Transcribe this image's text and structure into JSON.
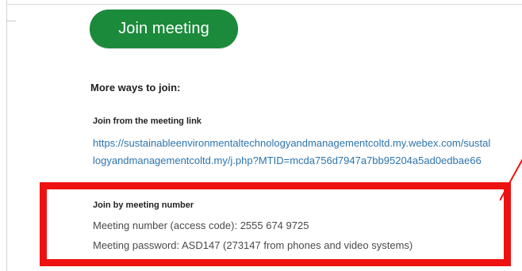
{
  "button": {
    "label": "Join meeting",
    "color": "#1b8a3b"
  },
  "more_ways": {
    "title": "More ways to join:"
  },
  "link_section": {
    "label": "Join from the meeting link",
    "line1": "https://sustainableenvironmentaltechnologyandmanagementcoltd.my.webex.com/sustal",
    "line2": "logyandmanagementcoltd.my/j.php?MTID=mcda756d7947a7bb95204a5ad0edbae66",
    "color": "#2c74ad"
  },
  "number_section": {
    "label": "Join by meeting number",
    "meeting_number": "Meeting number (access code): 2555 674 9725",
    "meeting_password": "Meeting password: ASD147 (273147 from phones and video systems)"
  },
  "annotation": {
    "highlight_color": "#ee1111"
  }
}
